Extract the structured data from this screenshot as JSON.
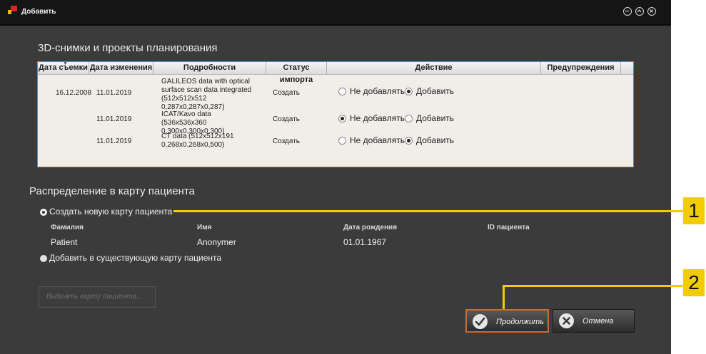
{
  "window": {
    "title": "Добавить"
  },
  "scans_section": {
    "title": "3D-снимки и проекты планирования"
  },
  "table": {
    "headers": [
      "Дата съемки",
      "Дата изменения",
      "Подробности",
      "Статус импорта",
      "Действие",
      "Предупреждения"
    ],
    "option_skip": "Не добавлять",
    "option_add": "Добавить",
    "rows": [
      {
        "capture_date": "16.12.2008",
        "modified_date": "11.01.2019",
        "details": "GALILEOS data with optical surface scan data integrated (512x512x512 0,287x0,287x0,287)",
        "status": "Создать",
        "action": "add"
      },
      {
        "capture_date": "",
        "modified_date": "11.01.2019",
        "details": "ICAT/Kavo data (536x536x360 0,300x0,300x0,300)",
        "status": "Создать",
        "action": "skip"
      },
      {
        "capture_date": "",
        "modified_date": "11.01.2019",
        "details": "CT data (512x512x191 0,268x0,268x0,500)",
        "status": "Создать",
        "action": "add"
      }
    ]
  },
  "patient_section": {
    "title": "Распределение в карту пациента",
    "option_new": "Создать новую карту пациента",
    "option_existing": "Добавить в существующую карту пациента",
    "selected": "new",
    "headers": [
      "Фамилия",
      "Имя",
      "Дата рождения",
      "ID пациента"
    ],
    "values": {
      "last_name": "Patient",
      "first_name": "Anonymer",
      "birth_date": "01.01.1967",
      "patient_id": ""
    }
  },
  "buttons": {
    "select_patient": "Выбрать карту пациента...",
    "continue": "Продолжить",
    "cancel": "Отмена"
  },
  "callouts": [
    "1",
    "2"
  ],
  "colors": {
    "accent": "#c76c34",
    "callout": "#f1cd00",
    "window_bg": "#3b3b3b"
  }
}
